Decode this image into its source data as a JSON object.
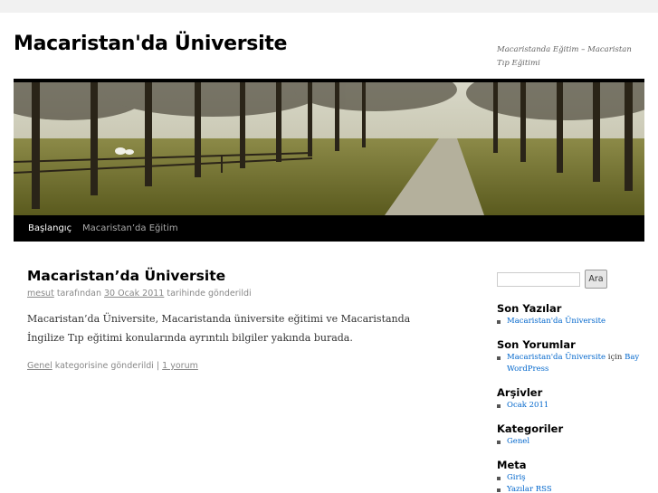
{
  "site": {
    "title": "Macaristan'da Üniversite",
    "description": "Macaristanda Eğitim – Macaristan Tıp Eğitimi"
  },
  "nav": [
    {
      "label": "Başlangıç",
      "current": true
    },
    {
      "label": "Macaristan’da Eğitim",
      "current": false
    }
  ],
  "post": {
    "title": "Macaristan’da Üniversite",
    "author": "mesut",
    "by_text": " tarafından ",
    "date": "30 Ocak 2011",
    "date_suffix": " tarihinde gönderildi",
    "body": "Macaristan’da Üniversite, Macaristanda üniversite eğitimi ve Macaristanda İngilize Tıp eğitimi konularında ayrıntılı bilgiler yakında burada.",
    "category": "Genel",
    "category_suffix": " kategorisine gönderildi | ",
    "comments": "1 yorum"
  },
  "sidebar": {
    "search_button": "Ara",
    "recent_posts_title": "Son Yazılar",
    "recent_posts": [
      "Macaristan'da Üniversite"
    ],
    "recent_comments_title": "Son Yorumlar",
    "recent_comment": {
      "post": "Macaristan'da Üniversite",
      "connector": " için ",
      "author": "Bay WordPress"
    },
    "archives_title": "Arşivler",
    "archives": [
      "Ocak 2011"
    ],
    "categories_title": "Kategoriler",
    "categories": [
      "Genel"
    ],
    "meta_title": "Meta",
    "meta": [
      "Giriş",
      "Yazılar RSS"
    ]
  },
  "colors": {
    "link": "#0066cc",
    "nav_bg": "#000000",
    "page_bg": "#f1f1f1"
  }
}
